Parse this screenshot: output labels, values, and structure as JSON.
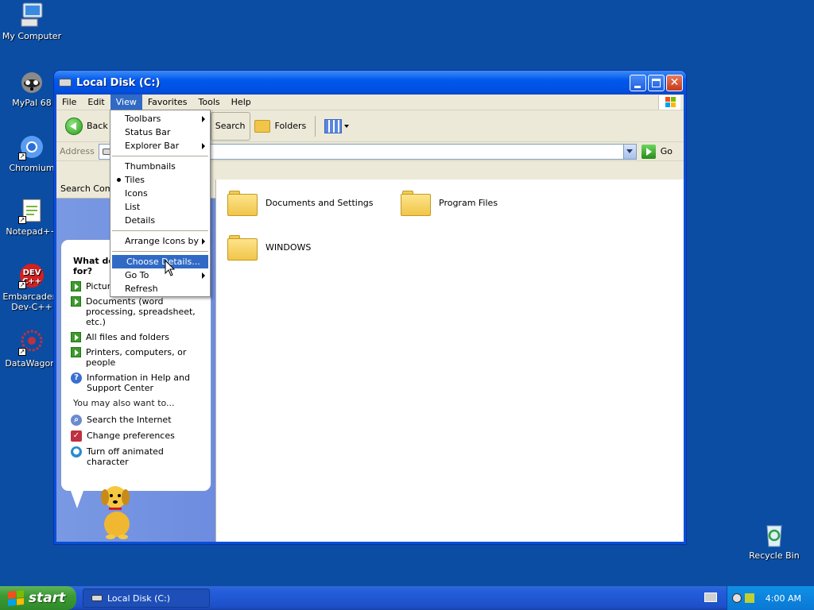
{
  "desktop": {
    "icons": [
      {
        "label": "My Computer"
      },
      {
        "label": "MyPal 68"
      },
      {
        "label": "Chromium"
      },
      {
        "label": "Notepad++"
      },
      {
        "label": "Embarcadero\nDev-C++"
      },
      {
        "label": "DataWagon."
      },
      {
        "label": "Recycle Bin"
      }
    ]
  },
  "window": {
    "title": "Local Disk (C:)",
    "menu": [
      "File",
      "Edit",
      "View",
      "Favorites",
      "Tools",
      "Help"
    ],
    "active_menu": "View",
    "toolbar": {
      "back": "Back",
      "search": "Search",
      "folders": "Folders"
    },
    "address": {
      "label": "Address",
      "value": "",
      "go": "Go"
    },
    "search_companion_title": "Search Comp",
    "folders": [
      {
        "name": "Documents and Settings"
      },
      {
        "name": "Program Files"
      },
      {
        "name": "WINDOWS"
      }
    ]
  },
  "view_menu": {
    "items": [
      "Toolbars",
      "Status Bar",
      "Explorer Bar",
      "Thumbnails",
      "Tiles",
      "Icons",
      "List",
      "Details",
      "Arrange Icons by",
      "Choose Details...",
      "Go To",
      "Refresh"
    ],
    "checked": "Tiles",
    "highlighted": "Choose Details..."
  },
  "search_panel": {
    "heading": "What do\nfor?",
    "options": [
      "Pictur",
      "Documents (word processing, spreadsheet, etc.)",
      "All files and folders",
      "Printers, computers, or people",
      "Information in Help and Support Center"
    ],
    "also_heading": "You may also want to...",
    "also": [
      "Search the Internet",
      "Change preferences",
      "Turn off animated character"
    ]
  },
  "taskbar": {
    "start": "start",
    "task": "Local Disk (C:)",
    "clock": "4:00 AM"
  },
  "colors": {
    "desktop": "#0b4da2",
    "menu_highlight": "#316ac5",
    "taskbar": "#245edb"
  }
}
